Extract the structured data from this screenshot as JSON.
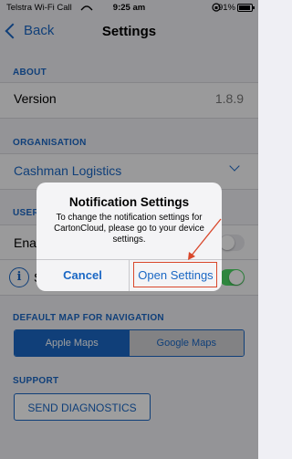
{
  "status_bar": {
    "carrier": "Telstra Wi-Fi Call",
    "time": "9:25 am",
    "battery": "91%"
  },
  "nav": {
    "back_label": "Back",
    "title": "Settings"
  },
  "about": {
    "header": "ABOUT",
    "version_label": "Version",
    "version_value": "1.8.9"
  },
  "organisation": {
    "header": "ORGANISATION",
    "name": "Cashman Logistics"
  },
  "user": {
    "header_visible": "USER",
    "row1_label_visible": "Enab",
    "row2_label_visible": "S"
  },
  "map": {
    "header": "DEFAULT MAP FOR NAVIGATION",
    "options": [
      "Apple Maps",
      "Google Maps"
    ],
    "selected": "Apple Maps"
  },
  "support": {
    "header": "SUPPORT",
    "button": "SEND DIAGNOSTICS"
  },
  "alert": {
    "title": "Notification Settings",
    "message": "To change the notification settings for CartonCloud, please go to your device settings.",
    "cancel": "Cancel",
    "confirm": "Open Settings"
  },
  "colors": {
    "accent": "#1a67c4",
    "toggle_on": "#4cd964",
    "annotation": "#d9472b"
  }
}
